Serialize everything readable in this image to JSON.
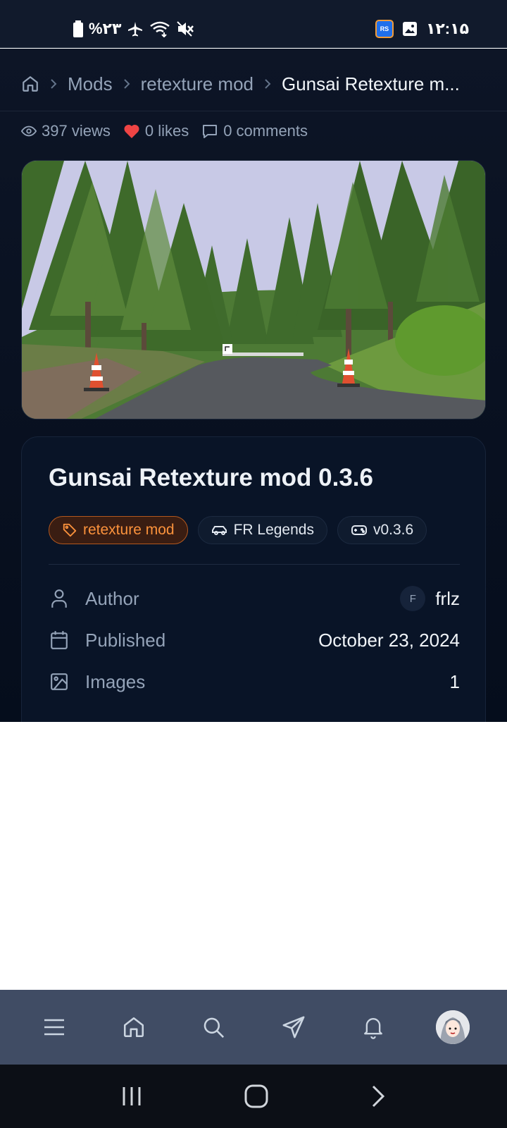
{
  "status_bar": {
    "battery": "%۲۳",
    "time": "۱۲:۱۵",
    "rs_badge": "RS"
  },
  "breadcrumb": {
    "items": [
      "Mods",
      "retexture mod",
      "Gunsai Retexture m..."
    ]
  },
  "stats": {
    "views": "397 views",
    "likes": "0 likes",
    "comments": "0 comments"
  },
  "mod": {
    "title": "Gunsai Retexture mod 0.3.6",
    "tags": [
      "retexture mod",
      "FR Legends",
      "v0.3.6"
    ],
    "author_label": "Author",
    "author_initial": "F",
    "author_name": "frlz",
    "published_label": "Published",
    "published_value": "October 23, 2024",
    "images_label": "Images",
    "images_value": "1"
  },
  "colors": {
    "background": "#0d1526",
    "card": "#091427",
    "accent": "#fb923c",
    "heart": "#ef4444",
    "bottom_nav": "#404c64"
  },
  "bottom_nav": {
    "icons": [
      "menu-icon",
      "home-icon",
      "search-icon",
      "send-icon",
      "bell-icon",
      "profile-avatar"
    ]
  }
}
